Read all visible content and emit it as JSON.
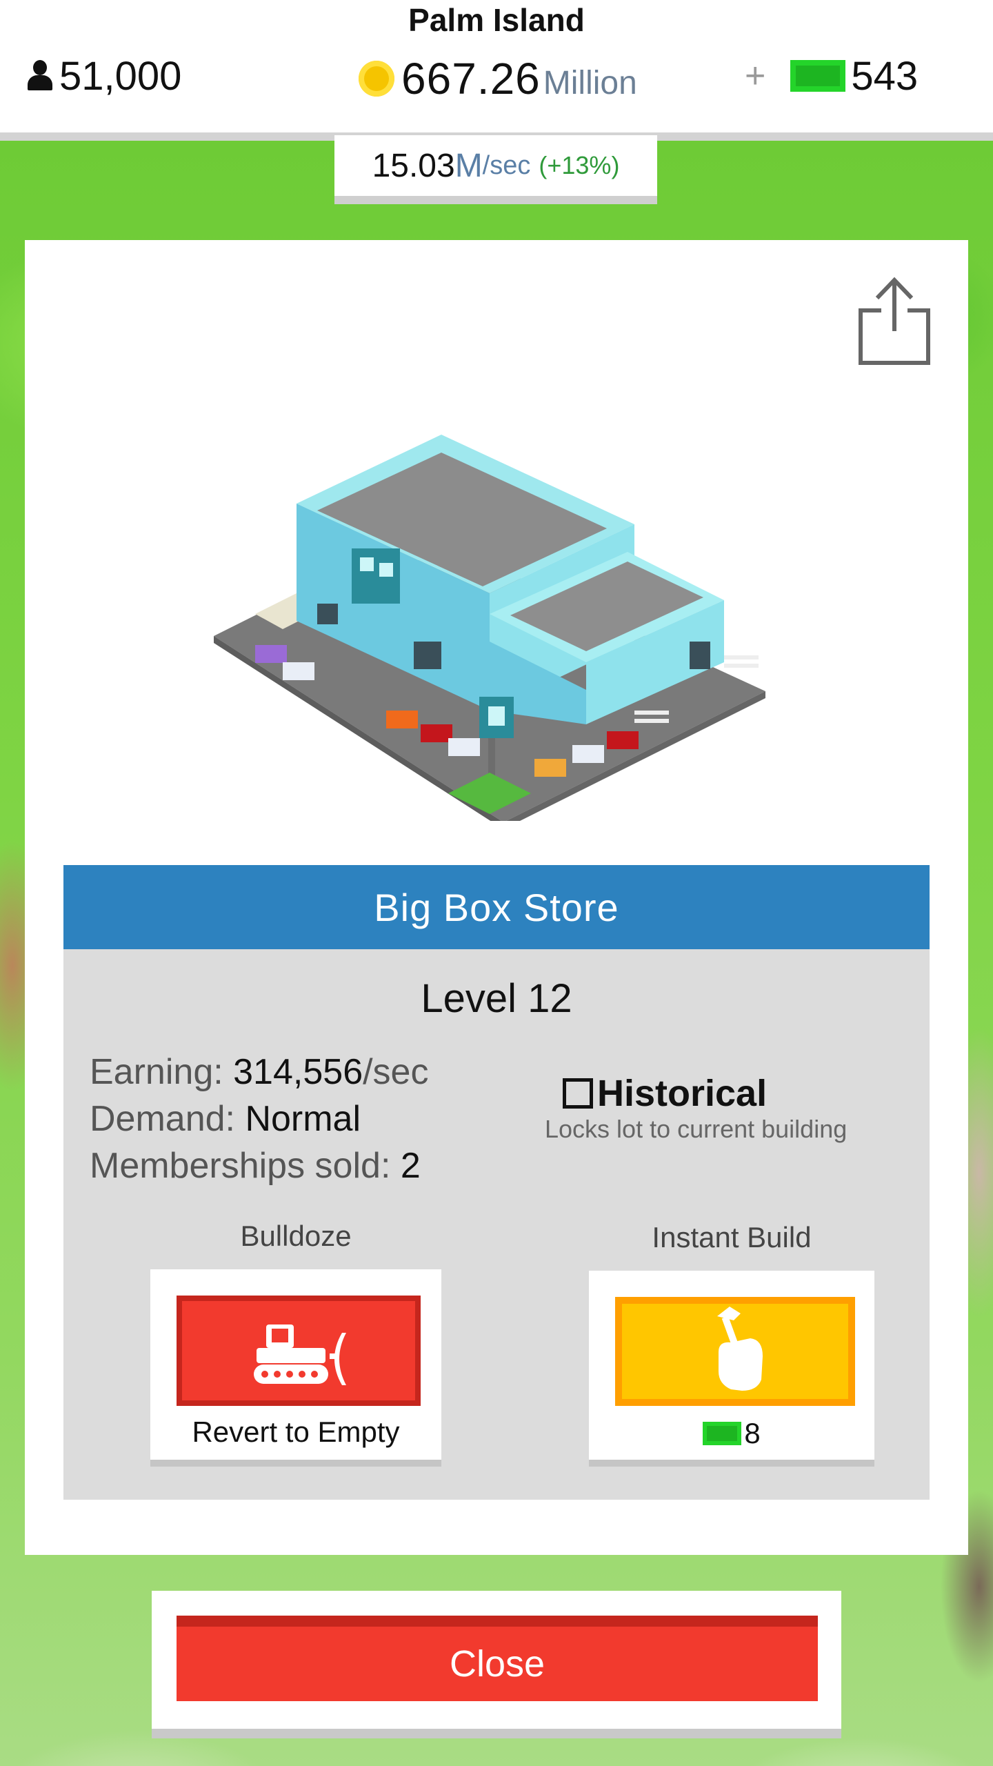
{
  "header": {
    "city_name": "Palm Island",
    "population": "51,000",
    "money": "667.26",
    "money_unit": "Million",
    "gems": "543",
    "income_rate": "15.03",
    "income_unit": "M",
    "income_per": "/sec",
    "income_bonus": "(+13%)"
  },
  "building": {
    "name": "Big Box Store",
    "level": "Level 12",
    "earning_label": "Earning: ",
    "earning_value": "314,556",
    "earning_suffix": "/sec",
    "demand_label": "Demand: ",
    "demand_value": "Normal",
    "memberships_label": "Memberships sold: ",
    "memberships_value": "2",
    "historical_label": "Historical",
    "historical_checked": false,
    "historical_desc": "Locks lot to current building"
  },
  "actions": {
    "bulldoze_label": "Bulldoze",
    "bulldoze_caption": "Revert to Empty",
    "instant_build_label": "Instant Build",
    "instant_build_cost": "8"
  },
  "close_label": "Close",
  "colors": {
    "title_bar": "#2d82bf",
    "bulldoze": "#f23a2e",
    "instant_build": "#ffc600",
    "gem": "#1db521",
    "coin": "#f5c400"
  }
}
